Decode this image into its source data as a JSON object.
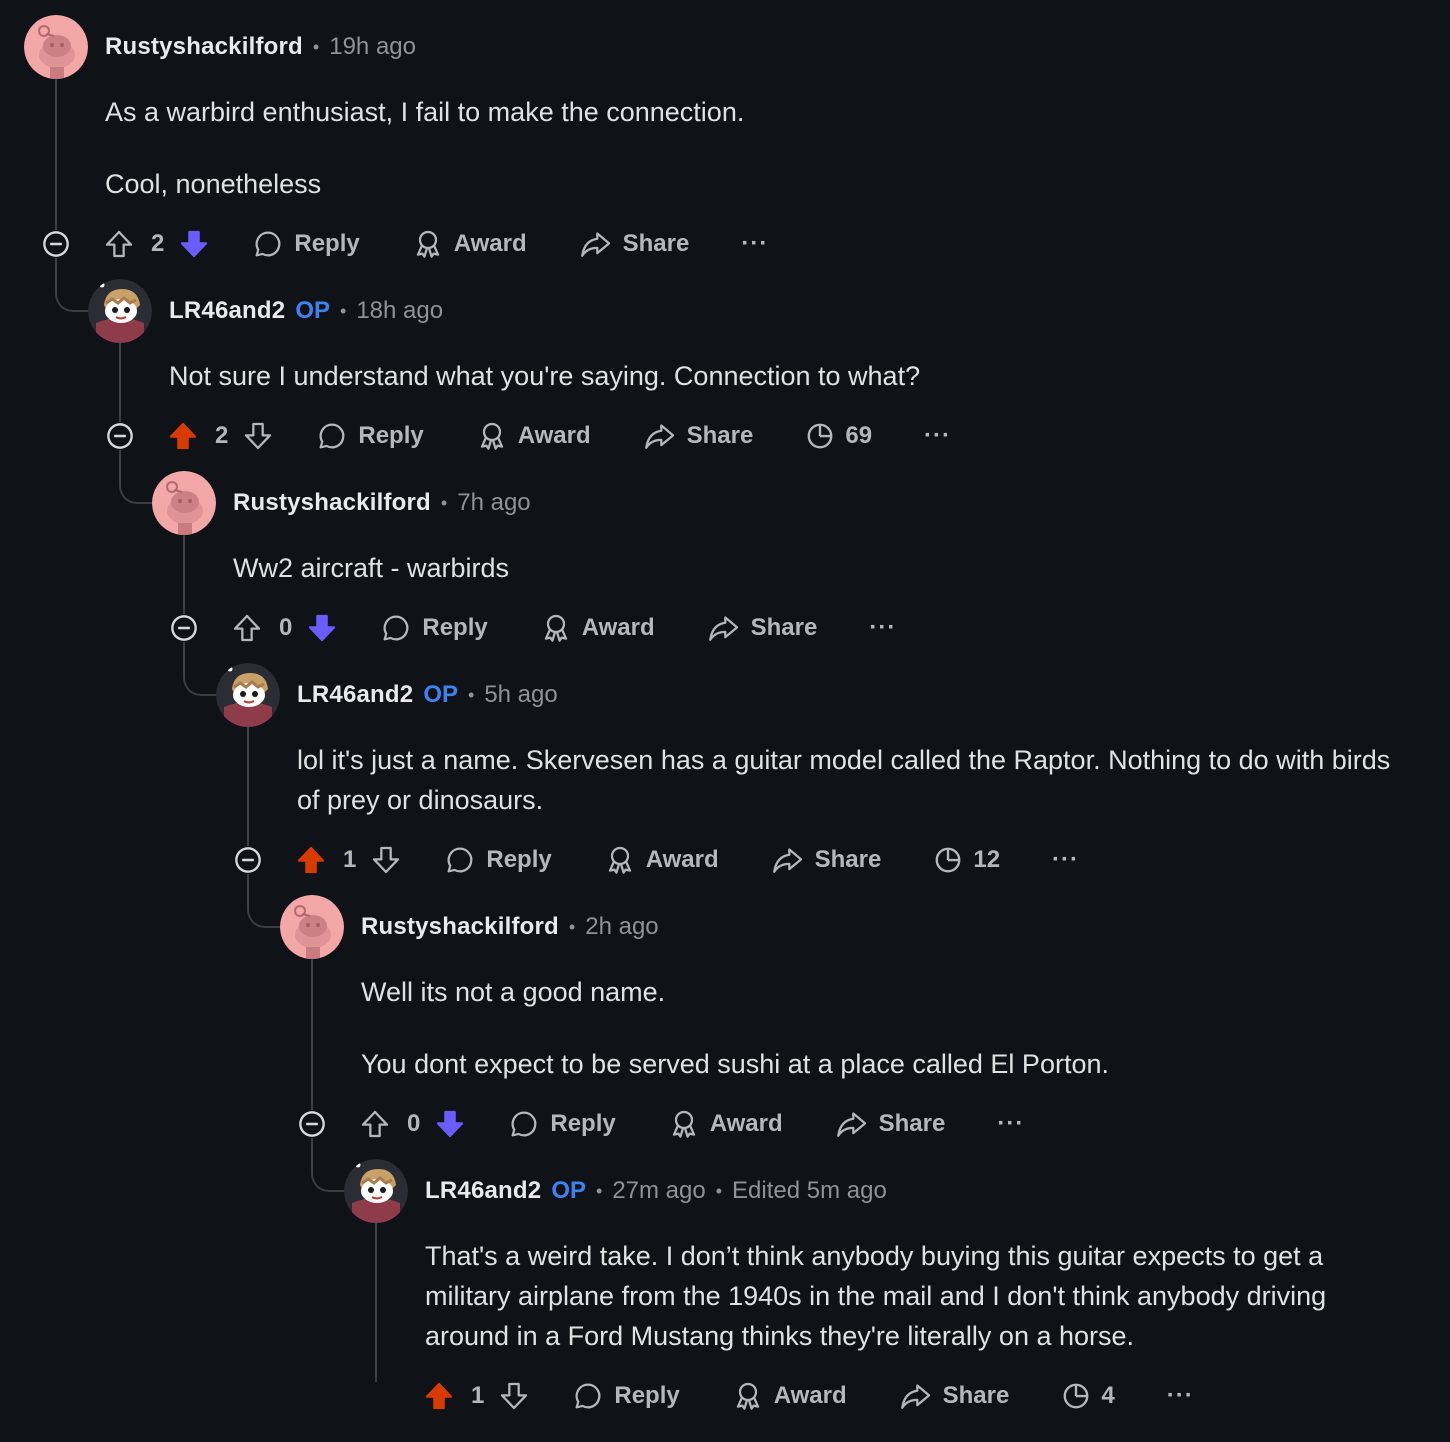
{
  "comments": [
    {
      "author": "Rustyshackilford",
      "op": "",
      "time": "19h ago",
      "edited": "",
      "body": [
        "As a warbird enthusiast, I fail to make the connection.",
        "Cool, nonetheless"
      ],
      "score": "2",
      "vote": "down",
      "views": ""
    },
    {
      "author": "LR46and2",
      "op": "OP",
      "time": "18h ago",
      "edited": "",
      "body": [
        "Not sure I understand what you're saying. Connection to what?"
      ],
      "score": "2",
      "vote": "up",
      "views": "69"
    },
    {
      "author": "Rustyshackilford",
      "op": "",
      "time": "7h ago",
      "edited": "",
      "body": [
        "Ww2 aircraft - warbirds"
      ],
      "score": "0",
      "vote": "down",
      "views": ""
    },
    {
      "author": "LR46and2",
      "op": "OP",
      "time": "5h ago",
      "edited": "",
      "body": [
        "lol it's just a name. Skervesen has a guitar model called the Raptor. Nothing to do with birds of prey or dinosaurs."
      ],
      "score": "1",
      "vote": "up",
      "views": "12"
    },
    {
      "author": "Rustyshackilford",
      "op": "",
      "time": "2h ago",
      "edited": "",
      "body": [
        "Well its not a good name.",
        "You dont expect to be served sushi at a place called El Porton."
      ],
      "score": "0",
      "vote": "down",
      "views": ""
    },
    {
      "author": "LR46and2",
      "op": "OP",
      "time": "27m ago",
      "edited": "Edited 5m ago",
      "body": [
        "That's a weird take. I don’t think anybody buying this guitar expects to get a military airplane from the 1940s in the mail and I don't think anybody driving around in a Ford Mustang thinks they're literally on a horse."
      ],
      "score": "1",
      "vote": "up",
      "views": "4"
    }
  ],
  "labels": {
    "reply": "Reply",
    "award": "Award",
    "share": "Share",
    "more": "···"
  },
  "colors": {
    "upvote": "#d93a00",
    "downvote": "#6a5cff",
    "op": "#3d82f0",
    "background": "#0f1216"
  },
  "icons": {
    "upvote": "arrow-up-icon",
    "downvote": "arrow-down-icon",
    "reply": "speech-bubble-icon",
    "award": "award-ribbon-icon",
    "share": "share-arrow-icon",
    "views": "views-clock-icon",
    "collapse": "minus-circle-icon",
    "more": "ellipsis-icon"
  }
}
